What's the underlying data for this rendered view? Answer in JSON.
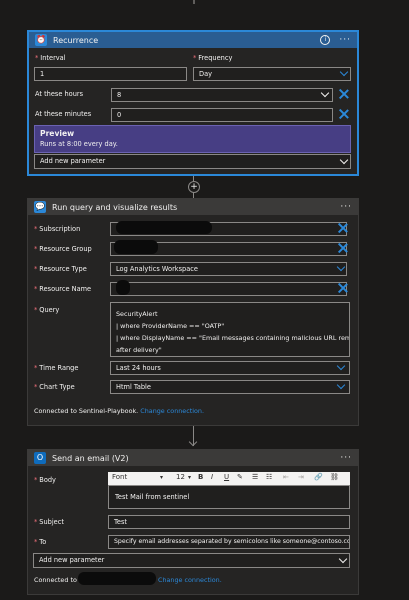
{
  "recurrence": {
    "title": "Recurrence",
    "interval_label": "Interval",
    "interval_value": "1",
    "frequency_label": "Frequency",
    "frequency_value": "Day",
    "hours_label": "At these hours",
    "hours_value": "8",
    "minutes_label": "At these minutes",
    "minutes_value": "0",
    "preview_title": "Preview",
    "preview_text": "Runs at 8:00 every day.",
    "add_param": "Add new parameter"
  },
  "query": {
    "title": "Run query and visualize results",
    "subscription_label": "Subscription",
    "resource_group_label": "Resource Group",
    "resource_type_label": "Resource Type",
    "resource_type_value": "Log Analytics Workspace",
    "resource_name_label": "Resource Name",
    "query_label": "Query",
    "query_lines": [
      "SecurityAlert",
      "| where ProviderName == \"OATP\"",
      "| where DisplayName == \"Email messages containing malicious URL removed",
      "after delivery\""
    ],
    "time_range_label": "Time Range",
    "time_range_value": "Last 24 hours",
    "chart_type_label": "Chart Type",
    "chart_type_value": "Html Table",
    "connected_text": "Connected to Sentinel-Playbook.",
    "change_connection": "Change connection."
  },
  "email": {
    "title": "Send an email (V2)",
    "body_label": "Body",
    "font_name": "Font",
    "font_size": "12",
    "body_text": "Test Mail from sentinel",
    "subject_label": "Subject",
    "subject_value": "Test",
    "to_label": "To",
    "to_placeholder": "Specify email addresses separated by semicolons like someone@contoso.com",
    "add_param": "Add new parameter",
    "connected_text": "Connected to",
    "change_connection": "Change connection."
  },
  "toolbar_glyphs": {
    "bold": "B",
    "italic": "I",
    "underline": "U",
    "bullets": "☰",
    "numbers": "☷",
    "outdent": "⇤",
    "indent": "⇥",
    "link": "🔗",
    "unlink": "⛓"
  },
  "icons": {
    "recurrence": "alarm-clock-icon",
    "query": "chat-bubble-icon",
    "email": "outlook-icon"
  },
  "colors": {
    "accent": "#2b88d8",
    "selected_header": "#2a5d92",
    "preview_bg": "#473e84"
  }
}
